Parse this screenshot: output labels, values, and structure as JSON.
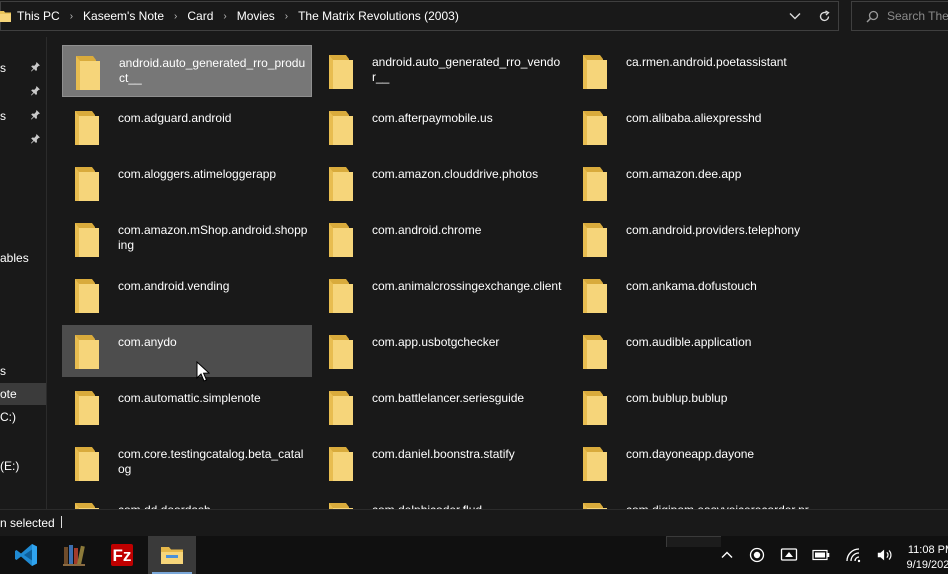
{
  "address_bar": {
    "crumbs": [
      "This PC",
      "Kaseem's Note",
      "Card",
      "Movies",
      "The Matrix Revolutions (2003)"
    ]
  },
  "search": {
    "placeholder": "Search The"
  },
  "nav": {
    "items": [
      {
        "label": "s",
        "pinned": true
      },
      {
        "label": "",
        "pinned": true
      },
      {
        "label": "s",
        "pinned": true
      },
      {
        "label": "",
        "pinned": true
      },
      {
        "label": "ables",
        "pinned": false
      },
      {
        "label": "s",
        "pinned": false
      },
      {
        "label": "ote",
        "pinned": false,
        "selected": true
      },
      {
        "label": "C:)",
        "pinned": false
      },
      {
        "label": "(E:)",
        "pinned": false
      }
    ]
  },
  "files": [
    "android.auto_generated_rro_product__",
    "android.auto_generated_rro_vendor__",
    "ca.rmen.android.poetassistant",
    "com.adguard.android",
    "com.afterpaymobile.us",
    "com.alibaba.aliexpresshd",
    "com.aloggers.atimeloggerapp",
    "com.amazon.clouddrive.photos",
    "com.amazon.dee.app",
    "com.amazon.mShop.android.shopping",
    "com.android.chrome",
    "com.android.providers.telephony",
    "com.android.vending",
    "com.animalcrossingexchange.client",
    "com.ankama.dofustouch",
    "com.anydo",
    "com.app.usbotgchecker",
    "com.audible.application",
    "com.automattic.simplenote",
    "com.battlelancer.seriesguide",
    "com.bublup.bublup",
    "com.core.testingcatalog.beta_catalog",
    "com.daniel.boonstra.statify",
    "com.dayoneapp.dayone",
    "com.dd.doordash",
    "com.delphicoder.flud",
    "com.digipom.easyvoicerecorder.pr"
  ],
  "selected_index": 0,
  "hover_index": 15,
  "status": {
    "text": "n selected"
  },
  "taskbar": {
    "apps": [
      "vscode-icon",
      "library-icon",
      "filezilla-icon",
      "file-explorer-icon"
    ],
    "clock_time": "11:08 PM",
    "clock_date": "9/19/2020"
  },
  "colors": {
    "background": "#191919",
    "selected_tile": "#777777",
    "hover_tile": "#4d4d4d",
    "folder_yellow": "#f5d06a"
  }
}
